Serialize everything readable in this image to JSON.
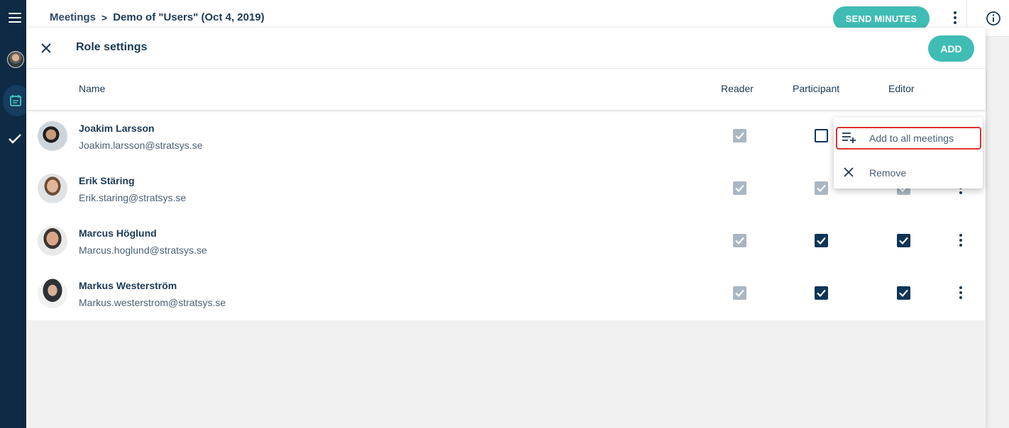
{
  "breadcrumb": {
    "parent": "Meetings",
    "separator": ">",
    "current": "Demo of \"Users\" (Oct 4, 2019)"
  },
  "toolbar": {
    "send_minutes_label": "SEND MINUTES"
  },
  "dialog": {
    "title": "Role settings",
    "add_label": "ADD",
    "columns": {
      "name": "Name",
      "reader": "Reader",
      "participant": "Participant",
      "editor": "Editor"
    },
    "people": [
      {
        "name": "Joakim Larsson",
        "email": "Joakim.larsson@stratsys.se",
        "reader": "checked-disabled",
        "participant": "unchecked",
        "editor": "hidden-by-menu"
      },
      {
        "name": "Erik Stäring",
        "email": "Erik.staring@stratsys.se",
        "reader": "checked-disabled",
        "participant": "checked-disabled",
        "editor": "checked-disabled"
      },
      {
        "name": "Marcus Höglund",
        "email": "Marcus.hoglund@stratsys.se",
        "reader": "checked-disabled",
        "participant": "checked",
        "editor": "checked"
      },
      {
        "name": "Markus Westerström",
        "email": "Markus.westerstrom@stratsys.se",
        "reader": "checked-disabled",
        "participant": "checked",
        "editor": "checked"
      }
    ]
  },
  "context_menu": {
    "items": [
      {
        "label": "Add to all meetings",
        "icon": "playlist-add-icon",
        "highlighted": true
      },
      {
        "label": "Remove",
        "icon": "close-icon",
        "highlighted": false
      }
    ]
  },
  "colors": {
    "rail": "#0e2a44",
    "accent": "#3fbdb5",
    "checkbox": "#0e3558",
    "checkbox_disabled": "#aab6c1",
    "highlight": "#e0312f"
  }
}
